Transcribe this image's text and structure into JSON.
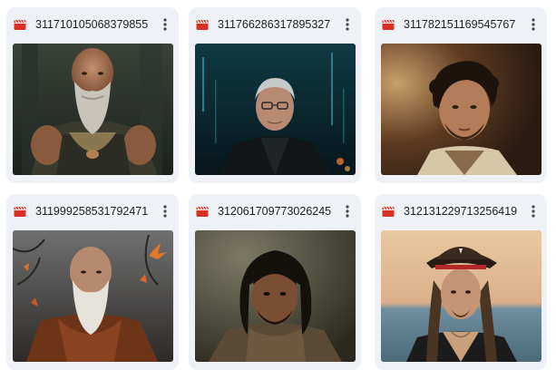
{
  "files": [
    {
      "name": "311710105068379855",
      "icon": "video-file-icon",
      "thumbnail": "bald-bearded-warrior"
    },
    {
      "name": "311766286317895327",
      "icon": "video-file-icon",
      "thumbnail": "older-man-glasses-city"
    },
    {
      "name": "311782151169545767",
      "icon": "video-file-icon",
      "thumbnail": "curly-haired-man"
    },
    {
      "name": "311999258531792471",
      "icon": "video-file-icon",
      "thumbnail": "old-monk-autumn"
    },
    {
      "name": "312061709773026245",
      "icon": "video-file-icon",
      "thumbnail": "long-haired-man"
    },
    {
      "name": "312131229713256419",
      "icon": "video-file-icon",
      "thumbnail": "pirate-beach"
    }
  ],
  "colors": {
    "card_background": "#eef1f6",
    "video_icon": "#d93025",
    "text": "#1f1f1f",
    "menu_dots": "#444746"
  }
}
